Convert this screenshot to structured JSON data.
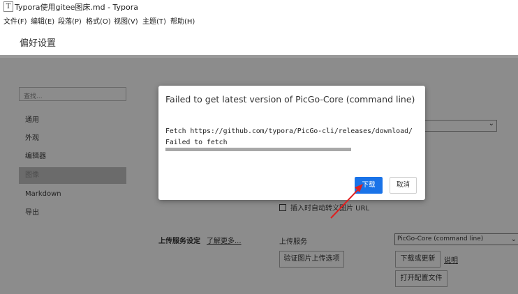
{
  "window": {
    "title": "Typora使用gitee图床.md - Typora",
    "icon_letter": "T"
  },
  "menubar": [
    "文件(F)",
    "编辑(E)",
    "段落(P)",
    "格式(O)",
    "视图(V)",
    "主题(T)",
    "帮助(H)"
  ],
  "prefs": {
    "title": "偏好设置",
    "search_placeholder": "查找...",
    "nav": [
      {
        "label": "通用",
        "active": false
      },
      {
        "label": "外观",
        "active": false
      },
      {
        "label": "编辑器",
        "active": false
      },
      {
        "label": "图像",
        "active": true
      },
      {
        "label": "Markdown",
        "active": false
      },
      {
        "label": "导出",
        "active": false
      }
    ],
    "image": {
      "insert_checkbox_label": "插入时自动转义图片 URL",
      "insert_checkbox_checked": false,
      "upload_heading": "上传服务设定",
      "learn_more": "了解更多...",
      "upload_service_label": "上传服务",
      "upload_service_value": "PicGo-Core (command line)",
      "verify_button": "验证图片上传选项",
      "download_update_button": "下载或更新",
      "help_link": "说明",
      "open_config_button": "打开配置文件"
    }
  },
  "dialog": {
    "title": "Failed to get latest version of PicGo-Core (command line)",
    "line1": "Fetch https://github.com/typora/PicGo-cli/releases/download/",
    "line2": "Failed to fetch",
    "progress": 1.0,
    "primary_button": "下载",
    "secondary_button": "取消"
  },
  "colors": {
    "overlay": "#8c8c8c",
    "accent": "#1a73e8",
    "annotation_arrow": "#e02020"
  }
}
